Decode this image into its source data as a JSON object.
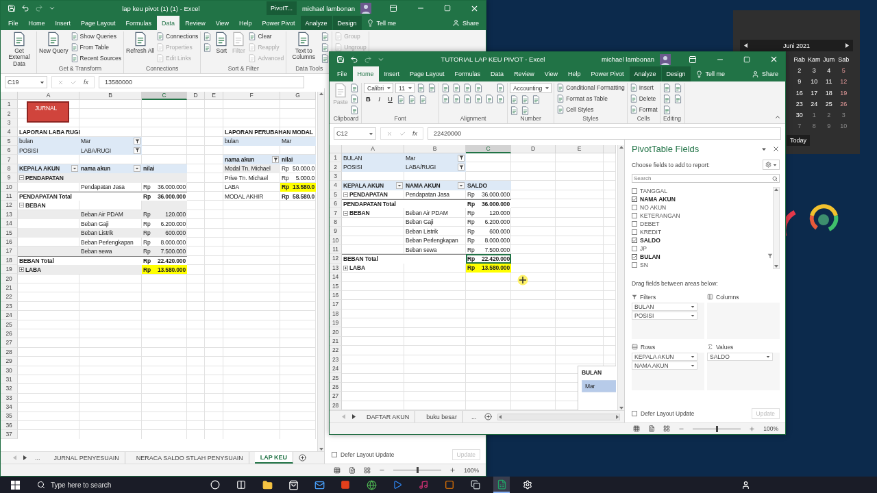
{
  "windows": [
    {
      "title_bar": {
        "title": "lap keu pivot (1) (1) - Excel",
        "context_label": "PivotT...",
        "user": "michael lambonan"
      },
      "tabs": [
        {
          "label": "File",
          "selected": false,
          "context": false
        },
        {
          "label": "Home",
          "selected": false,
          "context": false
        },
        {
          "label": "Insert",
          "selected": false,
          "context": false
        },
        {
          "label": "Page Layout",
          "selected": false,
          "context": false
        },
        {
          "label": "Formulas",
          "selected": false,
          "context": false
        },
        {
          "label": "Data",
          "selected": true,
          "context": false
        },
        {
          "label": "Review",
          "selected": false,
          "context": false
        },
        {
          "label": "View",
          "selected": false,
          "context": false
        },
        {
          "label": "Help",
          "selected": false,
          "context": false
        },
        {
          "label": "Power Pivot",
          "selected": false,
          "context": false
        },
        {
          "label": "Analyze",
          "selected": false,
          "context": true
        },
        {
          "label": "Design",
          "selected": false,
          "context": true
        }
      ],
      "tell_me": "Tell me",
      "share": "Share",
      "ribbon": [
        {
          "columns": [
            [
              {
                "kind": "large",
                "label": "Get External Data",
                "disabled": false
              }
            ]
          ]
        },
        {
          "label": "Get & Transform",
          "columns": [
            [
              {
                "kind": "large",
                "label": "New Query",
                "disabled": false
              }
            ],
            [
              {
                "kind": "small",
                "label": "Show Queries",
                "disabled": false
              },
              {
                "kind": "small",
                "label": "From Table",
                "disabled": false
              },
              {
                "kind": "small",
                "label": "Recent Sources",
                "disabled": false
              }
            ]
          ]
        },
        {
          "label": "Connections",
          "columns": [
            [
              {
                "kind": "large",
                "label": "Refresh All",
                "disabled": false
              }
            ],
            [
              {
                "kind": "small",
                "label": "Connections",
                "disabled": false
              },
              {
                "kind": "small",
                "label": "Properties",
                "disabled": true
              },
              {
                "kind": "small",
                "label": "Edit Links",
                "disabled": true
              }
            ]
          ]
        },
        {
          "label": "Sort & Filter",
          "columns": [
            [
              {
                "kind": "icon",
                "disabled": false
              },
              {
                "kind": "icon",
                "disabled": false
              }
            ],
            [
              {
                "kind": "large",
                "label": "Sort",
                "disabled": false
              }
            ],
            [
              {
                "kind": "large",
                "label": "Filter",
                "disabled": true
              }
            ],
            [
              {
                "kind": "small",
                "label": "Clear",
                "disabled": false
              },
              {
                "kind": "small",
                "label": "Reapply",
                "disabled": true
              },
              {
                "kind": "small",
                "label": "Advanced",
                "disabled": true
              }
            ]
          ]
        },
        {
          "label": "Data Tools",
          "columns": [
            [
              {
                "kind": "large",
                "label": "Text to Columns",
                "disabled": false
              }
            ],
            [
              {
                "kind": "icon",
                "disabled": false
              },
              {
                "kind": "icon",
                "disabled": false
              },
              {
                "kind": "icon",
                "disabled": false
              }
            ]
          ]
        },
        {
          "columns": [
            [
              {
                "kind": "small",
                "label": "Group",
                "disabled": true
              },
              {
                "kind": "small",
                "label": "Ungroup",
                "disabled": true
              }
            ]
          ]
        }
      ],
      "formula_bar": {
        "name_box": "C19",
        "fx": "fx",
        "value": "13580000"
      },
      "sheet": {
        "columns": [
          {
            "label": "A",
            "selected": false
          },
          {
            "label": "B",
            "selected": false
          },
          {
            "label": "C",
            "selected": true
          },
          {
            "label": "D",
            "selected": false
          },
          {
            "label": "E",
            "selected": false
          },
          {
            "label": "F",
            "selected": false
          },
          {
            "label": "G",
            "selected": false
          }
        ],
        "shape": {
          "label": "JURNAL"
        },
        "rows": [
          {
            "n": "1"
          },
          {
            "n": "2"
          },
          {
            "n": "3"
          },
          {
            "n": "4",
            "cells": [
              {
                "text": "LAPORAN LABA RUGI",
                "kind": "bold"
              },
              {},
              {},
              {},
              {},
              {
                "text": "LAPORAN PERUBAHAN MODAL",
                "kind": "bold"
              }
            ]
          },
          {
            "n": "5",
            "cells": [
              {
                "text": "bulan",
                "kind": "filter"
              },
              {
                "text": "Mar",
                "kind": "filter",
                "filtered": true
              },
              {},
              {},
              {},
              {
                "text": "bulan",
                "kind": "filter"
              },
              {
                "text": "Mar",
                "kind": "filter"
              }
            ]
          },
          {
            "n": "6",
            "cells": [
              {
                "text": "POSISI",
                "kind": "filter"
              },
              {
                "text": "LABA/RUGI",
                "kind": "filter",
                "filtered": true
              }
            ]
          },
          {
            "n": "7",
            "cells": [
              {},
              {},
              {},
              {},
              {},
              {
                "text": "nama akun",
                "kind": "header",
                "filtered": true
              },
              {
                "text": "nilai",
                "kind": "header"
              }
            ]
          },
          {
            "n": "8",
            "cells": [
              {
                "text": "KEPALA AKUN",
                "kind": "header",
                "filtered": false
              },
              {
                "text": "nama akun",
                "kind": "header",
                "filtered": false
              },
              {
                "text": "nilai",
                "kind": "header"
              },
              {},
              {},
              {
                "text": "Modal Tn. Michael",
                "kind": "band"
              },
              {
                "currency": "Rp",
                "amount": "50.000.0"
              }
            ]
          },
          {
            "n": "9",
            "cells": [
              {
                "text": "PENDAPATAN",
                "kind": "band_bold",
                "expanded": true
              },
              {
                "kind": "band"
              },
              {
                "kind": "band"
              },
              {},
              {},
              {
                "text": "Prive Tn. Michael"
              },
              {
                "currency": "Rp",
                "amount": "5.000.0"
              }
            ]
          },
          {
            "n": "10",
            "cells": [
              {},
              {
                "text": "Pendapatan Jasa"
              },
              {
                "currency": "Rp",
                "amount": "36.000.000"
              },
              {},
              {},
              {
                "text": "LABA"
              },
              {
                "currency": "Rp",
                "amount": "13.580.0",
                "kind": "highlight"
              }
            ]
          },
          {
            "n": "11",
            "cells": [
              {
                "text": "PENDAPATAN Total",
                "kind": "total"
              },
              {
                "kind": "total"
              },
              {
                "currency": "Rp",
                "amount": "36.000.000",
                "kind": "total"
              },
              {},
              {},
              {
                "text": "MODAL AKHIR"
              },
              {
                "currency": "Rp",
                "amount": "58.580.0",
                "kind": "bold"
              }
            ]
          },
          {
            "n": "12",
            "cells": [
              {
                "text": "BEBAN",
                "kind": "bold",
                "expanded": true
              },
              {},
              {
                "kind": "band"
              }
            ]
          },
          {
            "n": "13",
            "cells": [
              {
                "kind": "band"
              },
              {
                "text": "Beban Air PDAM",
                "kind": "band"
              },
              {
                "currency": "Rp",
                "amount": "120.000",
                "kind": "band"
              }
            ]
          },
          {
            "n": "14",
            "cells": [
              {},
              {
                "text": "Beban Gaji"
              },
              {
                "currency": "Rp",
                "amount": "6.200.000"
              }
            ]
          },
          {
            "n": "15",
            "cells": [
              {
                "kind": "band"
              },
              {
                "text": "Beban Listrik",
                "kind": "band"
              },
              {
                "currency": "Rp",
                "amount": "600.000",
                "kind": "band"
              }
            ]
          },
          {
            "n": "16",
            "cells": [
              {},
              {
                "text": "Beban Perlengkapan"
              },
              {
                "currency": "Rp",
                "amount": "8.000.000"
              }
            ]
          },
          {
            "n": "17",
            "cells": [
              {
                "kind": "band"
              },
              {
                "text": "Beban sewa",
                "kind": "band"
              },
              {
                "currency": "Rp",
                "amount": "7.500.000",
                "kind": "band"
              }
            ]
          },
          {
            "n": "18",
            "cells": [
              {
                "text": "BEBAN Total",
                "kind": "total"
              },
              {
                "kind": "total"
              },
              {
                "currency": "Rp",
                "amount": "22.420.000",
                "kind": "total"
              }
            ]
          },
          {
            "n": "19",
            "cells": [
              {
                "text": "LABA",
                "kind": "band_bold",
                "expanded": false
              },
              {
                "kind": "band"
              },
              {
                "currency": "Rp",
                "amount": "13.580.000",
                "kind": "highlight"
              }
            ]
          },
          {
            "n": "20"
          },
          {
            "n": "21"
          },
          {
            "n": "22"
          },
          {
            "n": "23"
          },
          {
            "n": "24"
          },
          {
            "n": "25"
          },
          {
            "n": "26"
          },
          {
            "n": "27"
          },
          {
            "n": "28"
          },
          {
            "n": "29"
          },
          {
            "n": "30"
          },
          {
            "n": "31"
          },
          {
            "n": "32"
          },
          {
            "n": "33"
          },
          {
            "n": "34"
          },
          {
            "n": "35"
          },
          {
            "n": "36"
          },
          {
            "n": "37"
          }
        ]
      },
      "sheet_tabs": [
        {
          "kind": "ellipsis",
          "label": "...",
          "selected": false
        },
        {
          "kind": "sheet",
          "label": "JURNAL PENYESUAIN",
          "selected": false
        },
        {
          "kind": "sheet",
          "label": "NERACA SALDO STLAH PENYSUAIN",
          "selected": false
        },
        {
          "kind": "sheet",
          "label": "LAP KEU",
          "selected": true
        }
      ],
      "pane": {
        "defer": {
          "label": "Defer Layout Update",
          "checked": false
        },
        "update": {
          "label": "Update",
          "disabled": true
        }
      },
      "status": {
        "zoom": {
          "level": 0.5,
          "reading": "100%"
        }
      }
    },
    {
      "title_bar": {
        "title": "TUTORIAL LAP KEU PIVOT - Excel",
        "user": "michael lambonan"
      },
      "tabs": [
        {
          "label": "File",
          "selected": false,
          "context": false
        },
        {
          "label": "Home",
          "selected": true,
          "context": false
        },
        {
          "label": "Insert",
          "selected": false,
          "context": false
        },
        {
          "label": "Page Layout",
          "selected": false,
          "context": false
        },
        {
          "label": "Formulas",
          "selected": false,
          "context": false
        },
        {
          "label": "Data",
          "selected": false,
          "context": false
        },
        {
          "label": "Review",
          "selected": false,
          "context": false
        },
        {
          "label": "View",
          "selected": false,
          "context": false
        },
        {
          "label": "Help",
          "selected": false,
          "context": false
        },
        {
          "label": "Power Pivot",
          "selected": false,
          "context": false
        },
        {
          "label": "Analyze",
          "selected": false,
          "context": true
        },
        {
          "label": "Design",
          "selected": false,
          "context": true
        }
      ],
      "tell_me": "Tell me",
      "share": "Share",
      "ribbon": [
        {
          "label": "Clipboard",
          "columns": [
            [
              {
                "kind": "large",
                "label": "Paste",
                "disabled": true
              }
            ],
            [
              {
                "kind": "icon",
                "disabled": false
              },
              {
                "kind": "icon",
                "disabled": false
              },
              {
                "kind": "icon",
                "disabled": false
              }
            ]
          ]
        },
        {
          "label": "Font",
          "columns": [
            [
              {
                "kind": "row",
                "items": [
                  {
                    "kind": "field",
                    "label": "Calibri",
                    "disabled": false
                  },
                  {
                    "kind": "field",
                    "label": "11",
                    "disabled": false
                  },
                  {
                    "kind": "icon",
                    "disabled": false
                  },
                  {
                    "kind": "icon",
                    "disabled": false
                  }
                ]
              },
              {
                "kind": "row",
                "items": [
                  {
                    "kind": "glyph",
                    "label": "B",
                    "disabled": false
                  },
                  {
                    "kind": "glyph",
                    "label": "I",
                    "disabled": false
                  },
                  {
                    "kind": "glyph",
                    "label": "U",
                    "disabled": false
                  },
                  {
                    "kind": "icon",
                    "disabled": false
                  },
                  {
                    "kind": "icon",
                    "disabled": false
                  },
                  {
                    "kind": "icon",
                    "disabled": false
                  }
                ]
              }
            ]
          ]
        },
        {
          "label": "Alignment",
          "columns": [
            [
              {
                "kind": "row",
                "items": [
                  {
                    "kind": "icon",
                    "disabled": false
                  },
                  {
                    "kind": "icon",
                    "disabled": false
                  },
                  {
                    "kind": "icon",
                    "disabled": false
                  },
                  {
                    "kind": "icon",
                    "disabled": false
                  }
                ]
              },
              {
                "kind": "row",
                "items": [
                  {
                    "kind": "icon",
                    "disabled": false
                  },
                  {
                    "kind": "icon",
                    "disabled": false
                  },
                  {
                    "kind": "icon",
                    "disabled": false
                  },
                  {
                    "kind": "icon",
                    "disabled": false
                  },
                  {
                    "kind": "icon",
                    "disabled": false
                  }
                ]
              }
            ],
            [
              {
                "kind": "icon",
                "disabled": false
              },
              {
                "kind": "icon",
                "disabled": false
              }
            ]
          ]
        },
        {
          "label": "Number",
          "columns": [
            [
              {
                "kind": "field",
                "label": "Accounting",
                "disabled": false
              },
              {
                "kind": "row",
                "items": [
                  {
                    "kind": "icon",
                    "disabled": false
                  },
                  {
                    "kind": "icon",
                    "disabled": false
                  },
                  {
                    "kind": "icon",
                    "disabled": false
                  }
                ]
              },
              {
                "kind": "row",
                "items": [
                  {
                    "kind": "icon",
                    "disabled": false
                  },
                  {
                    "kind": "icon",
                    "disabled": false
                  }
                ]
              }
            ]
          ]
        },
        {
          "label": "Styles",
          "columns": [
            [
              {
                "kind": "small",
                "label": "Conditional Formatting",
                "disabled": false
              },
              {
                "kind": "small",
                "label": "Format as Table",
                "disabled": false
              },
              {
                "kind": "small",
                "label": "Cell Styles",
                "disabled": false
              }
            ]
          ]
        },
        {
          "label": "Cells",
          "columns": [
            [
              {
                "kind": "small",
                "label": "Insert",
                "disabled": false
              },
              {
                "kind": "small",
                "label": "Delete",
                "disabled": false
              },
              {
                "kind": "small",
                "label": "Format",
                "disabled": false
              }
            ]
          ]
        },
        {
          "label": "Editing",
          "columns": [
            [
              {
                "kind": "icon",
                "disabled": false
              },
              {
                "kind": "icon",
                "disabled": false
              },
              {
                "kind": "icon",
                "disabled": false
              }
            ],
            [
              {
                "kind": "icon",
                "disabled": false
              },
              {
                "kind": "icon",
                "disabled": false
              }
            ]
          ]
        }
      ],
      "formula_bar": {
        "name_box": "C12",
        "fx": "fx",
        "value": "22420000"
      },
      "sheet": {
        "columns": [
          {
            "label": "A",
            "selected": false
          },
          {
            "label": "B",
            "selected": false
          },
          {
            "label": "C",
            "selected": true
          },
          {
            "label": "D",
            "selected": false
          },
          {
            "label": "E",
            "selected": false
          }
        ],
        "slicer": {
          "title": "BULAN",
          "items": [
            {
              "label": "Mar",
              "selected": true
            }
          ]
        },
        "rows": [
          {
            "n": "1",
            "cells": [
              {
                "text": "BULAN",
                "kind": "filter"
              },
              {
                "text": "Mar",
                "kind": "filter",
                "filtered": true
              }
            ]
          },
          {
            "n": "2",
            "cells": [
              {
                "text": "POSISI",
                "kind": "filter"
              },
              {
                "text": "LABA/RUGI",
                "kind": "filter",
                "filtered": true
              }
            ]
          },
          {
            "n": "3"
          },
          {
            "n": "4",
            "cells": [
              {
                "text": "KEPALA AKUN",
                "kind": "header",
                "filtered": false
              },
              {
                "text": "NAMA AKUN",
                "kind": "header",
                "filtered": false
              },
              {
                "text": "SALDO",
                "kind": "header"
              }
            ]
          },
          {
            "n": "5",
            "cells": [
              {
                "text": "PENDAPATAN",
                "kind": "bold",
                "expanded": true
              },
              {
                "text": "Pendapatan Jasa"
              },
              {
                "currency": "Rp",
                "amount": "36.000.000"
              }
            ]
          },
          {
            "n": "6",
            "cells": [
              {
                "text": "PENDAPATAN Total",
                "kind": "total"
              },
              {
                "kind": "total"
              },
              {
                "currency": "Rp",
                "amount": "36.000.000",
                "kind": "total"
              }
            ]
          },
          {
            "n": "7",
            "cells": [
              {
                "text": "BEBAN",
                "kind": "bold",
                "expanded": true
              },
              {
                "text": "Beban Air PDAM"
              },
              {
                "currency": "Rp",
                "amount": "120.000"
              }
            ]
          },
          {
            "n": "8",
            "cells": [
              {},
              {
                "text": "Beban Gaji"
              },
              {
                "currency": "Rp",
                "amount": "6.200.000"
              }
            ]
          },
          {
            "n": "9",
            "cells": [
              {},
              {
                "text": "Beban Listrik"
              },
              {
                "currency": "Rp",
                "amount": "600.000"
              }
            ]
          },
          {
            "n": "10",
            "cells": [
              {},
              {
                "text": "Beban Perlengkapan"
              },
              {
                "currency": "Rp",
                "amount": "8.000.000"
              }
            ]
          },
          {
            "n": "11",
            "cells": [
              {},
              {
                "text": "Beban sewa"
              },
              {
                "currency": "Rp",
                "amount": "7.500.000"
              }
            ]
          },
          {
            "n": "12",
            "cells": [
              {
                "text": "BEBAN Total",
                "kind": "total"
              },
              {
                "kind": "total"
              },
              {
                "currency": "Rp",
                "amount": "22.420.000",
                "kind": "selected"
              }
            ]
          },
          {
            "n": "13",
            "cells": [
              {
                "text": "LABA",
                "kind": "bold",
                "expanded": false
              },
              {},
              {
                "currency": "Rp",
                "amount": "13.580.000",
                "kind": "highlight"
              }
            ]
          },
          {
            "n": "14"
          },
          {
            "n": "15"
          },
          {
            "n": "16"
          },
          {
            "n": "17"
          },
          {
            "n": "18"
          },
          {
            "n": "19"
          },
          {
            "n": "20"
          },
          {
            "n": "21"
          },
          {
            "n": "22"
          },
          {
            "n": "23"
          },
          {
            "n": "24"
          },
          {
            "n": "25"
          },
          {
            "n": "26"
          },
          {
            "n": "27"
          },
          {
            "n": "28"
          }
        ]
      },
      "sheet_tabs": [
        {
          "kind": "sheet",
          "label": "DAFTAR AKUN",
          "selected": false
        },
        {
          "kind": "sheet",
          "label": "buku besar",
          "selected": false
        },
        {
          "kind": "ellipsis",
          "label": "...",
          "selected": false
        }
      ],
      "pane": {
        "title": "PivotTable Fields",
        "subtitle": "Choose fields to add to report:",
        "search_placeholder": "Search",
        "fields": [
          {
            "label": "TANGGAL",
            "checked": false,
            "filtered": false
          },
          {
            "label": "NAMA AKUN",
            "checked": true,
            "filtered": false
          },
          {
            "label": "NO AKUN",
            "checked": false,
            "filtered": false
          },
          {
            "label": "KETERANGAN",
            "checked": false,
            "filtered": false
          },
          {
            "label": "DEBET",
            "checked": false,
            "filtered": false
          },
          {
            "label": "KREDIT",
            "checked": false,
            "filtered": false
          },
          {
            "label": "SALDO",
            "checked": true,
            "filtered": false
          },
          {
            "label": "JP",
            "checked": false,
            "filtered": false
          },
          {
            "label": "BULAN",
            "checked": true,
            "filtered": true
          },
          {
            "label": "SN",
            "checked": false,
            "filtered": false
          }
        ],
        "drag_hint": "Drag fields between areas below:",
        "areas": [
          {
            "kind": "filters",
            "label": "Filters",
            "items": [
              "BULAN",
              "POSISI"
            ]
          },
          {
            "kind": "columns",
            "label": "Columns"
          },
          {
            "kind": "rows",
            "label": "Rows",
            "items": [
              "KEPALA AKUN",
              "NAMA AKUN"
            ]
          },
          {
            "kind": "values",
            "label": "Values",
            "items": [
              "SALDO"
            ]
          }
        ],
        "defer": {
          "label": "Defer Layout Update",
          "checked": false
        },
        "update": {
          "label": "Update",
          "disabled": true
        }
      },
      "status": {
        "zoom": {
          "level": 0.5,
          "reading": "100%"
        }
      }
    }
  ],
  "calendar": {
    "month": "Juni 2021",
    "weekdays": [
      "Rab",
      "Kam",
      "Jum",
      "Sab"
    ],
    "weeks": [
      [
        {
          "day": "2",
          "other_month": false
        },
        {
          "day": "3",
          "other_month": false
        },
        {
          "day": "4",
          "other_month": false
        },
        {
          "day": "5",
          "other_month": false
        }
      ],
      [
        {
          "day": "9",
          "other_month": false
        },
        {
          "day": "10",
          "other_month": false
        },
        {
          "day": "11",
          "other_month": false
        },
        {
          "day": "12",
          "other_month": false
        }
      ],
      [
        {
          "day": "16",
          "other_month": false
        },
        {
          "day": "17",
          "other_month": false
        },
        {
          "day": "18",
          "other_month": false
        },
        {
          "day": "19",
          "other_month": false
        }
      ],
      [
        {
          "day": "23",
          "other_month": false
        },
        {
          "day": "24",
          "other_month": false
        },
        {
          "day": "25",
          "other_month": false
        },
        {
          "day": "26",
          "other_month": false
        }
      ],
      [
        {
          "day": "30",
          "other_month": false
        },
        {
          "day": "1",
          "other_month": true
        },
        {
          "day": "2",
          "other_month": true
        },
        {
          "day": "3",
          "other_month": true
        }
      ],
      [
        {
          "day": "7",
          "other_month": true
        },
        {
          "day": "8",
          "other_month": true
        },
        {
          "day": "9",
          "other_month": true
        },
        {
          "day": "10",
          "other_month": true
        }
      ]
    ],
    "today": "Today"
  },
  "taskbar": {
    "search_placeholder": "Type here to search"
  }
}
